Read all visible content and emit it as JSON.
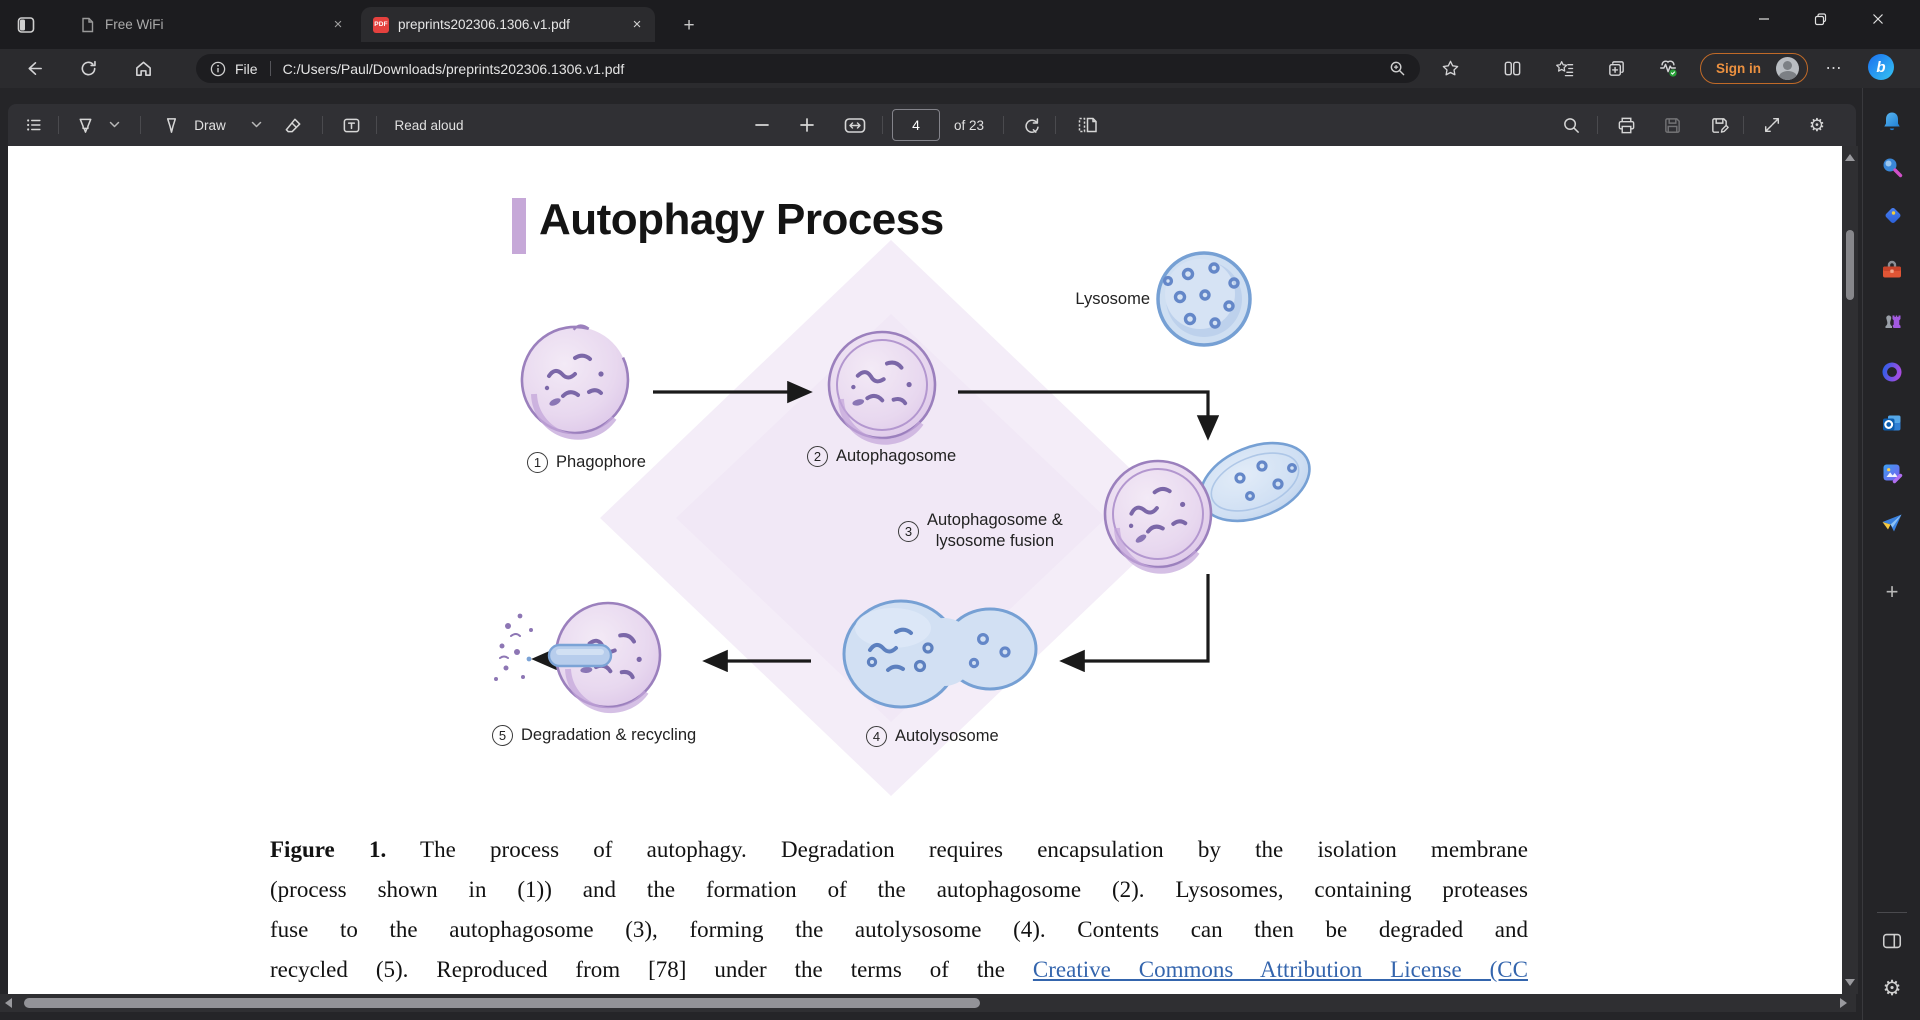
{
  "tab_bar": {
    "tabs": [
      {
        "title": "Free WiFi"
      },
      {
        "title": "preprints202306.1306.v1.pdf"
      }
    ],
    "pdf_badge": "PDF"
  },
  "address_bar": {
    "protocol_label": "File",
    "url": "C:/Users/Paul/Downloads/preprints202306.1306.v1.pdf",
    "sign_in_label": "Sign in"
  },
  "pdf_toolbar": {
    "draw_label": "Draw",
    "read_aloud_label": "Read aloud",
    "page_value": "4",
    "page_count_label": "of 23"
  },
  "page": {
    "title": "Autophagy Process",
    "diagram": {
      "lysosome_label": "Lysosome",
      "steps": [
        {
          "num": "1",
          "label": "Phagophore"
        },
        {
          "num": "2",
          "label": "Autophagosome"
        },
        {
          "num": "3",
          "label_line1": "Autophagosome &",
          "label_line2": "lysosome fusion"
        },
        {
          "num": "4",
          "label": "Autolysosome"
        },
        {
          "num": "5",
          "label": "Degradation & recycling"
        }
      ]
    },
    "caption": {
      "line1_bold": "Figure 1.",
      "line1_rest": " The process of autophagy. Degradation requires encapsulation by the isolation membrane",
      "line2": "(process shown in (1)) and the formation of the autophagosome (2). Lysosomes, containing proteases",
      "line3": "fuse to the autophagosome (3), forming the autolysosome (4). Contents can then be degraded and",
      "line4_pre": "recycled (5). Reproduced from [78] under the terms of the ",
      "line4_link": "Creative Commons Attribution License (CC"
    }
  },
  "sidebar": {
    "items": [
      "notifications",
      "search",
      "shopping",
      "toolbox",
      "games",
      "microsoft-365",
      "outlook",
      "designer",
      "drop",
      "add-to-sidebar"
    ],
    "bottom": [
      "sidebar-panel",
      "settings"
    ]
  },
  "icons": {
    "new_tab": "+",
    "close": "×",
    "more": "⋯",
    "settings_gear": "⚙"
  },
  "colors": {
    "accent_purple": "#c6a8d8",
    "link_blue": "#3465ad",
    "sign_in_orange": "#ec9140",
    "pdf_badge_red": "#e5413e",
    "diamond_lavender": "#f4edf8"
  }
}
